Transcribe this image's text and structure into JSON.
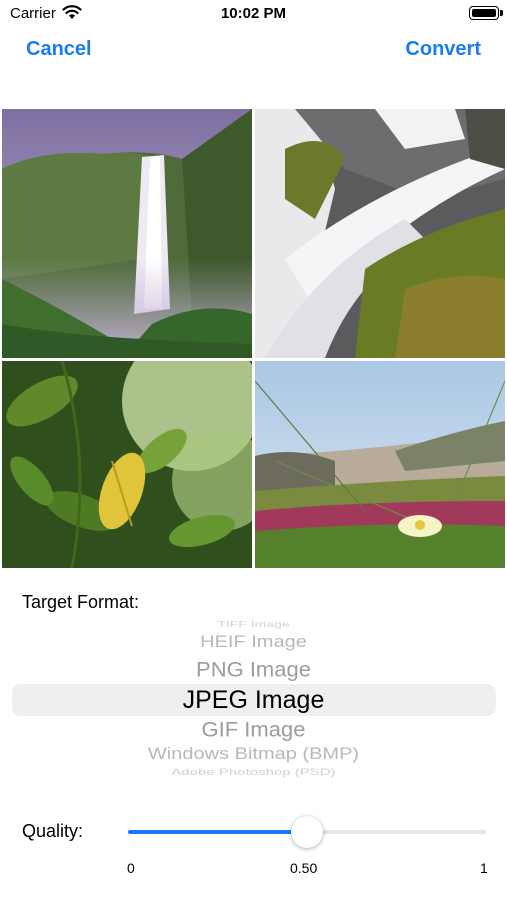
{
  "status_bar": {
    "carrier": "Carrier",
    "time": "10:02 PM"
  },
  "nav": {
    "cancel_label": "Cancel",
    "convert_label": "Convert"
  },
  "thumbnails": [
    {
      "name": "waterfall-cliff"
    },
    {
      "name": "cascade-rocks"
    },
    {
      "name": "green-leaves"
    },
    {
      "name": "coastal-flowers"
    }
  ],
  "format": {
    "label": "Target Format:",
    "options": [
      "TIFF Image",
      "HEIF Image",
      "PNG Image",
      "JPEG Image",
      "GIF Image",
      "Windows Bitmap (BMP)",
      "Adobe Photoshop (PSD)"
    ],
    "selected": "JPEG Image"
  },
  "quality": {
    "label": "Quality:",
    "min_label": "0",
    "value_label": "0.50",
    "max_label": "1",
    "value": 0.5
  },
  "colors": {
    "accent": "#1a7cf5",
    "track": "#e3e3e8",
    "selection": "#efeff0"
  }
}
